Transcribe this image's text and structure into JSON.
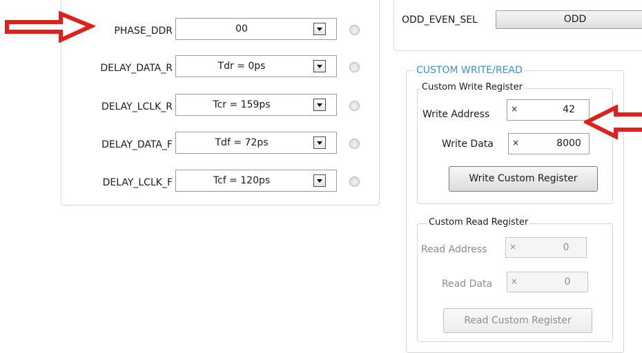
{
  "delay_settings": {
    "rows": [
      {
        "label": "PHASE_DDR",
        "value": "00"
      },
      {
        "label": "DELAY_DATA_R",
        "value": "Tdr = 0ps"
      },
      {
        "label": "DELAY_LCLK_R",
        "value": "Tcr = 159ps"
      },
      {
        "label": "DELAY_DATA_F",
        "value": "Tdf = 72ps"
      },
      {
        "label": "DELAY_LCLK_F",
        "value": "Tcf = 120ps"
      }
    ]
  },
  "odd_even": {
    "label": "ODD_EVEN_SEL",
    "value": "ODD"
  },
  "custom": {
    "title": "CUSTOM WRITE/READ",
    "title_color": "#3b8fd6",
    "write": {
      "title": "Custom Write Register",
      "address_label": "Write Address",
      "address_prefix": "×",
      "address_value": "42",
      "data_label": "Write Data",
      "data_prefix": "×",
      "data_value": "8000",
      "button": "Write Custom Register"
    },
    "read": {
      "title": "Custom Read Register",
      "address_label": "Read Address",
      "address_prefix": "×",
      "address_value": "0",
      "data_label": "Read Data",
      "data_prefix": "×",
      "data_value": "0",
      "button": "Read Custom Register"
    }
  },
  "annotations": {
    "arrow_color": "#e0201b"
  }
}
